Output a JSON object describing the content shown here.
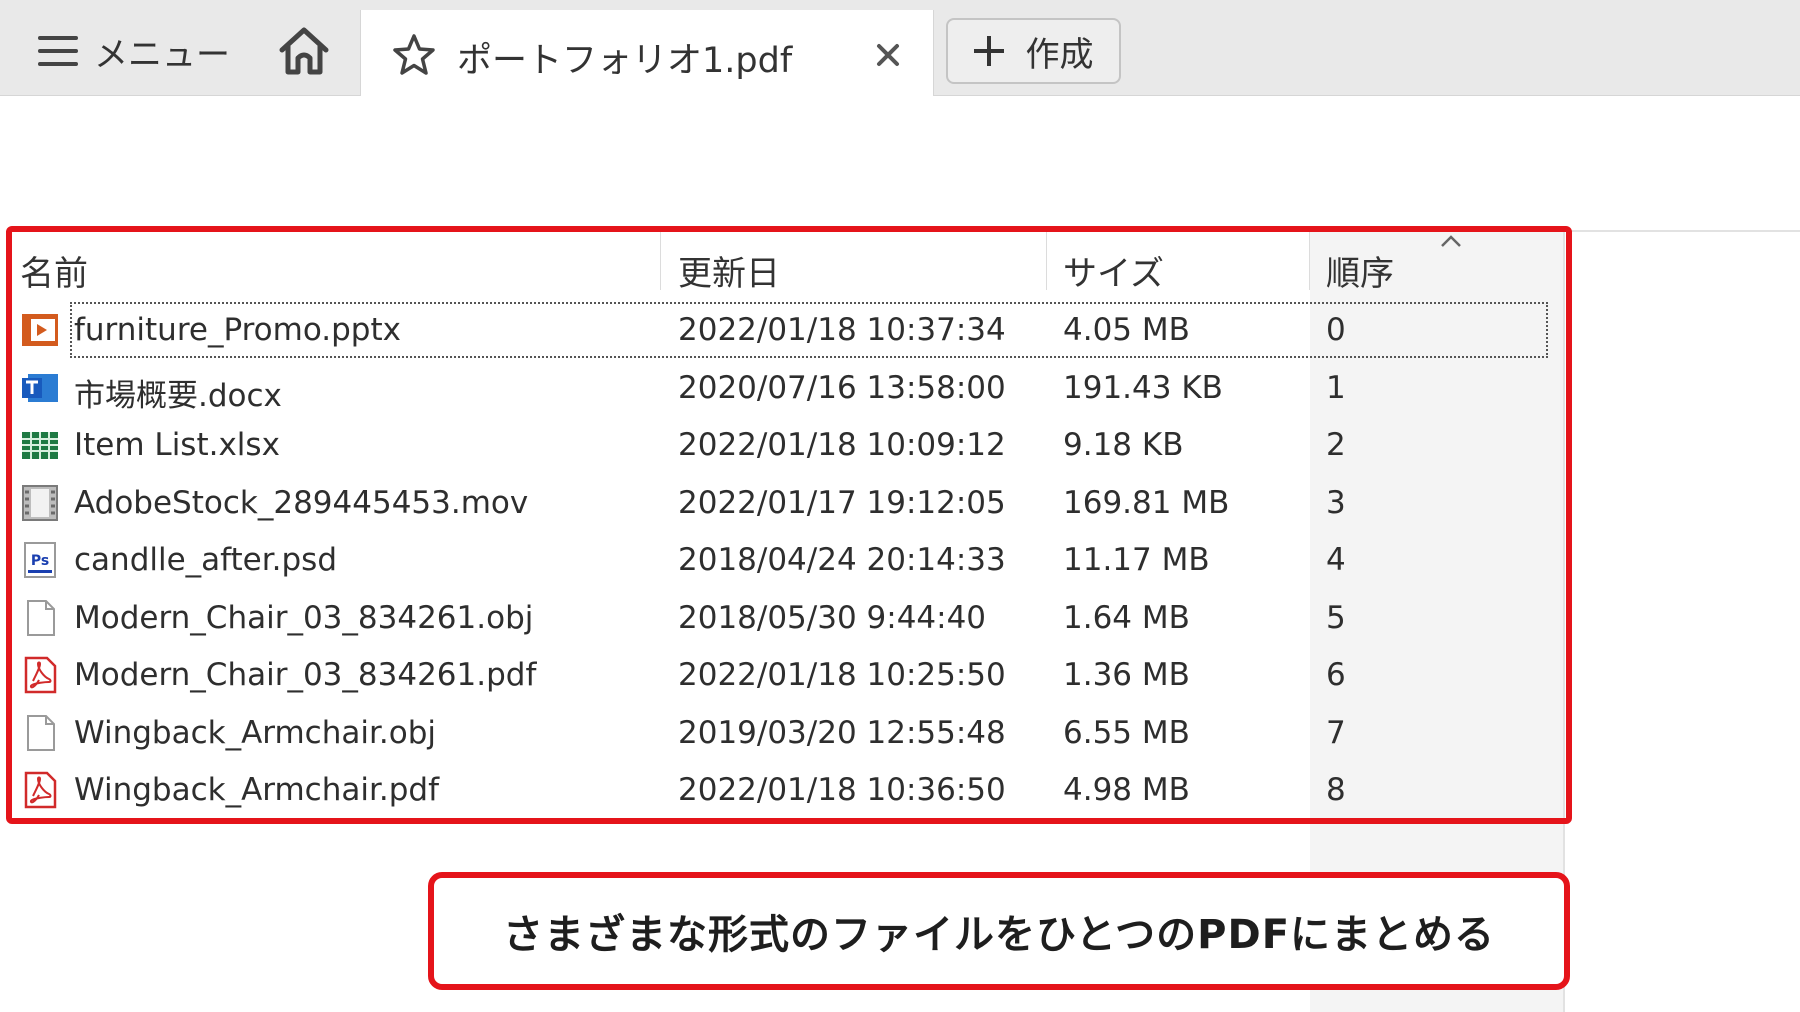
{
  "topbar": {
    "menu_label": "メニュー",
    "tab_title": "ポートフォリオ1.pdf",
    "create_label": "作成"
  },
  "table": {
    "columns": {
      "name": "名前",
      "date": "更新日",
      "size": "サイズ",
      "order": "順序"
    },
    "sort": {
      "column": "order",
      "direction": "ascending"
    },
    "rows": [
      {
        "name": "furniture_Promo.pptx",
        "date": "2022/01/18 10:37:34",
        "size": "4.05 MB",
        "order": "0",
        "icon": "pptx-icon"
      },
      {
        "name": "市場概要.docx",
        "date": "2020/07/16 13:58:00",
        "size": "191.43 KB",
        "order": "1",
        "icon": "docx-icon"
      },
      {
        "name": "Item List.xlsx",
        "date": "2022/01/18 10:09:12",
        "size": "9.18 KB",
        "order": "2",
        "icon": "xlsx-icon"
      },
      {
        "name": "AdobeStock_289445453.mov",
        "date": "2022/01/17 19:12:05",
        "size": "169.81 MB",
        "order": "3",
        "icon": "video-icon"
      },
      {
        "name": "candlle_after.psd",
        "date": "2018/04/24 20:14:33",
        "size": "11.17 MB",
        "order": "4",
        "icon": "psd-icon"
      },
      {
        "name": "Modern_Chair_03_834261.obj",
        "date": "2018/05/30 9:44:40",
        "size": "1.64 MB",
        "order": "5",
        "icon": "generic-file-icon"
      },
      {
        "name": "Modern_Chair_03_834261.pdf",
        "date": "2022/01/18 10:25:50",
        "size": "1.36 MB",
        "order": "6",
        "icon": "pdf-icon"
      },
      {
        "name": "Wingback_Armchair.obj",
        "date": "2019/03/20 12:55:48",
        "size": "6.55 MB",
        "order": "7",
        "icon": "generic-file-icon"
      },
      {
        "name": "Wingback_Armchair.pdf",
        "date": "2022/01/18 10:36:50",
        "size": "4.98 MB",
        "order": "8",
        "icon": "pdf-icon"
      }
    ]
  },
  "caption": "さまざまな形式のファイルをひとつのPDFにまとめる",
  "colors": {
    "highlight_red": "#e5141a",
    "topbar_bg": "#e9e9e9"
  }
}
